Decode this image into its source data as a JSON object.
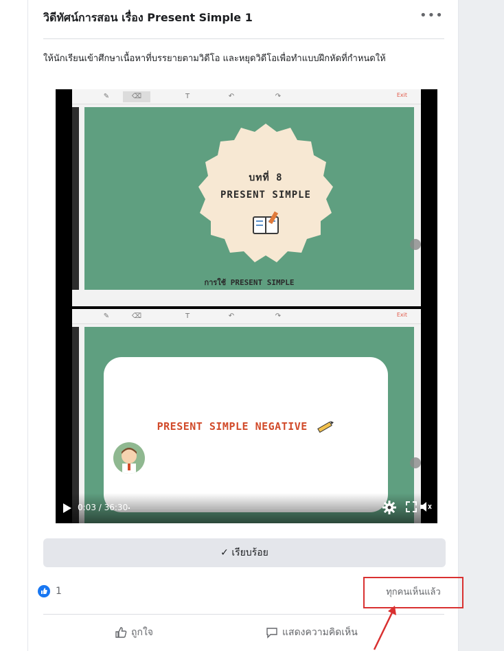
{
  "post": {
    "title": "วิดีทัศน์การสอน เรื่อง Present Simple 1",
    "more_label": "•••",
    "description": "ให้นักเรียนเข้าศึกษาเนื้อหาที่บรรยายตามวิดีโอ และหยุดวิดีโอเพื่อทำแบบฝึกหัดที่กำหนดให้"
  },
  "video": {
    "slide1": {
      "title_line1": "บทที่ 8",
      "title_line2": "PRESENT SIMPLE",
      "caption": "การใช้ PRESENT SIMPLE"
    },
    "slide2": {
      "heading": "PRESENT SIMPLE NEGATIVE"
    },
    "toolbar_exit": "Exit",
    "current_time": "0:03",
    "duration": "36:30",
    "time_display": "0:03 / 36:30",
    "progress": 0.0014
  },
  "actions": {
    "done_label": "✓ เรียบร้อย",
    "like_count": "1",
    "seen_by_label": "ทุกคนเห็นแล้ว",
    "like_label": "ถูกใจ",
    "comment_label": "แสดงความคิดเห็น"
  },
  "colors": {
    "accent": "#1877f2",
    "highlight_box": "#d93030",
    "slide_green": "#5f9f80",
    "badge_cream": "#f7e8d3"
  }
}
